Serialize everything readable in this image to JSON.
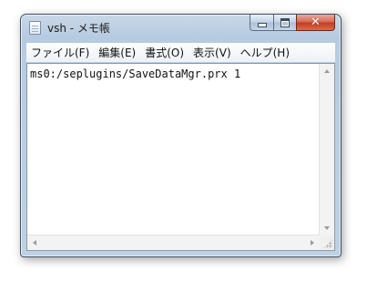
{
  "window": {
    "title": "vsh - メモ帳",
    "close_glyph": "✕"
  },
  "menu": [
    {
      "label": "ファイル(F)"
    },
    {
      "label": "編集(E)"
    },
    {
      "label": "書式(O)"
    },
    {
      "label": "表示(V)"
    },
    {
      "label": "ヘルプ(H)"
    }
  ],
  "editor": {
    "content": "ms0:/seplugins/SaveDataMgr.prx 1"
  },
  "icons": {
    "app": "notepad-icon",
    "minimize": "minimize-icon",
    "maximize": "maximize-icon",
    "close": "close-icon"
  },
  "colors": {
    "close_button": "#c4391f",
    "frame": "#bfd1e3"
  }
}
